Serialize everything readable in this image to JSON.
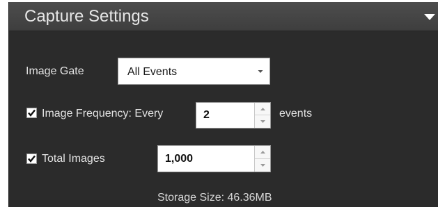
{
  "panel": {
    "title": "Capture Settings",
    "toggle_icon": "triangle-down-icon"
  },
  "image_gate": {
    "label": "Image Gate",
    "selected": "All Events",
    "dropdown_icon": "caret-down-icon"
  },
  "image_frequency": {
    "checked": true,
    "label": "Image Frequency: Every",
    "value": "2",
    "suffix": "events"
  },
  "total_images": {
    "checked": true,
    "label": "Total Images",
    "value": "1,000"
  },
  "storage": {
    "text": "Storage Size: 46.36MB"
  },
  "colors": {
    "panel_bg": "#2b2b2b",
    "header_bg": "#454545",
    "text": "#e3e3e3"
  }
}
